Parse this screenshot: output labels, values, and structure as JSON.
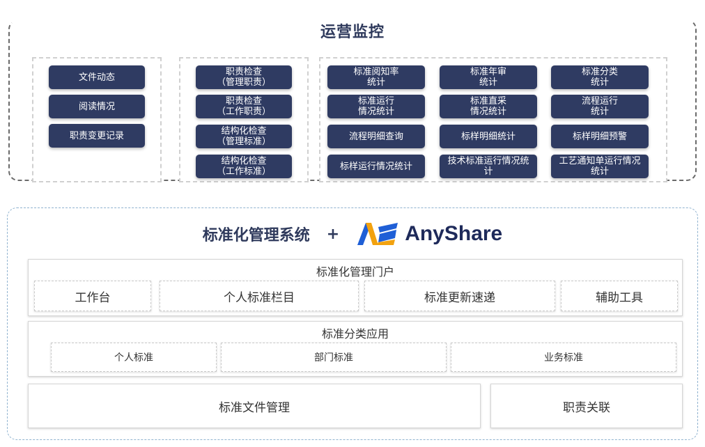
{
  "monitor": {
    "title": "运营监控",
    "group1": [
      "文件动态",
      "阅读情况",
      "职责变更记录"
    ],
    "group2": [
      "职责检查\n（管理职责）",
      "职责检查\n（工作职责）",
      "结构化检查\n（管理标准）",
      "结构化检查\n（工作标准）"
    ],
    "group3": [
      "标准阅知率\n统计",
      "标准年审\n统计",
      "标准分类\n统计",
      "标准运行\n情况统计",
      "标准直采\n情况统计",
      "流程运行\n统计",
      "流程明细查询",
      "标样明细统计",
      "标样明细预警",
      "标样运行情况统计",
      "技术标准运行情况统\n计",
      "工艺通知单运行情况\n统计"
    ]
  },
  "system": {
    "name": "标准化管理系统",
    "plus": "+",
    "brand": "AnyShare",
    "portal": {
      "title": "标准化管理门户",
      "items": [
        "工作台",
        "个人标准栏目",
        "标准更新速递",
        "辅助工具"
      ]
    },
    "classify": {
      "title": "标准分类应用",
      "items": [
        "个人标准",
        "部门标准",
        "业务标准"
      ]
    },
    "file_mgmt": "标准文件管理",
    "duty_link": "职责关联"
  },
  "colors": {
    "pill": "#2f3b62",
    "brand_blue": "#1f5fd6",
    "brand_orange": "#f2a20f",
    "frame_blue": "#8fb2cf"
  }
}
